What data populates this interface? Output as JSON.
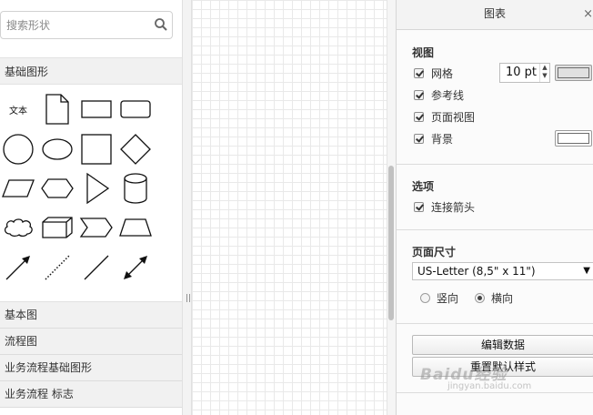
{
  "sidebar": {
    "search": {
      "placeholder": "搜索形状",
      "icon": "search-icon"
    },
    "section_title": "基础图形",
    "shapes": [
      {
        "name": "text",
        "label": "文本"
      },
      {
        "name": "note"
      },
      {
        "name": "rectangle"
      },
      {
        "name": "rounded-rectangle"
      },
      {
        "name": "circle"
      },
      {
        "name": "ellipse"
      },
      {
        "name": "square"
      },
      {
        "name": "diamond"
      },
      {
        "name": "parallelogram"
      },
      {
        "name": "hexagon"
      },
      {
        "name": "triangle"
      },
      {
        "name": "cylinder"
      },
      {
        "name": "cloud"
      },
      {
        "name": "cube"
      },
      {
        "name": "step"
      },
      {
        "name": "trapezoid"
      },
      {
        "name": "arrow-line"
      },
      {
        "name": "dotted-line"
      },
      {
        "name": "line"
      },
      {
        "name": "bidirectional-arrow"
      }
    ],
    "libraries": [
      "基本图",
      "流程图",
      "业务流程基础图形",
      "业务流程 标志"
    ]
  },
  "splitter": {
    "grip": "||"
  },
  "panel": {
    "title": "图表",
    "close_label": "×",
    "view": {
      "title": "视图",
      "grid_label": "网格",
      "grid_size": "10 pt",
      "grid_color": "#e0e0e0",
      "guides_label": "参考线",
      "page_view_label": "页面视图",
      "background_label": "背景",
      "background_color": "#ffffff"
    },
    "options": {
      "title": "选项",
      "connection_arrows_label": "连接箭头"
    },
    "page_size": {
      "title": "页面尺寸",
      "selected": "US-Letter (8,5\" x 11\")",
      "portrait_label": "竖向",
      "landscape_label": "横向"
    },
    "buttons": {
      "edit_data": "编辑数据",
      "reset_style": "重置默认样式"
    }
  },
  "watermark": {
    "main": "Baidu经验",
    "sub": "jingyan.baidu.com"
  }
}
